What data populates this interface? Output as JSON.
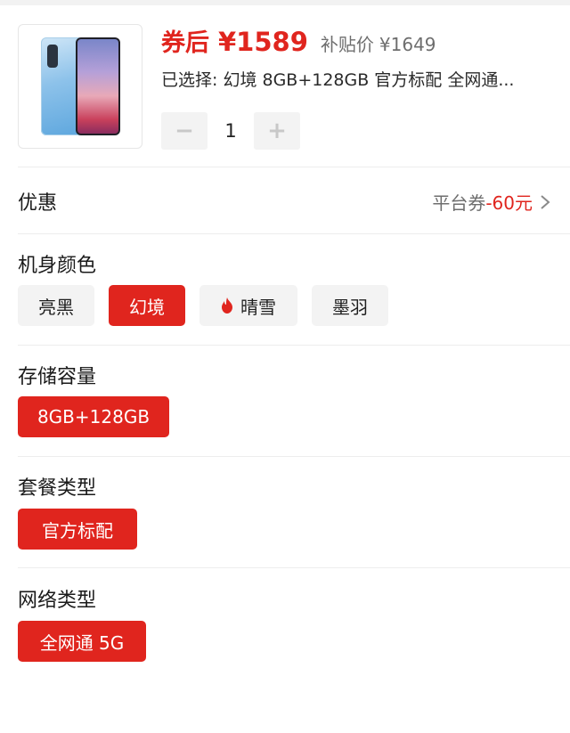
{
  "product": {
    "price_label": "券后",
    "price": "¥1589",
    "subsidy_label": "补贴价",
    "subsidy_price": "¥1649",
    "selected_text": "已选择: 幻境 8GB+128GB 官方标配 全网通...",
    "quantity": "1",
    "minus": "−",
    "plus": "+"
  },
  "promo": {
    "label": "优惠",
    "platform": "平台券",
    "amount": "-60元"
  },
  "sections": {
    "color": {
      "title": "机身颜色",
      "options": [
        "亮黑",
        "幻境",
        "晴雪",
        "墨羽"
      ],
      "selected": "幻境"
    },
    "storage": {
      "title": "存储容量",
      "options": [
        "8GB+128GB"
      ],
      "selected": "8GB+128GB"
    },
    "package": {
      "title": "套餐类型",
      "options": [
        "官方标配"
      ],
      "selected": "官方标配"
    },
    "network": {
      "title": "网络类型",
      "options": [
        "全网通 5G"
      ],
      "selected": "全网通 5G"
    }
  },
  "colors": {
    "accent": "#e0251e",
    "chip_bg": "#f3f3f3",
    "muted_text": "#6e6e6e"
  },
  "icons": {
    "hot": "flame-icon",
    "more": "chevron-right-icon"
  }
}
